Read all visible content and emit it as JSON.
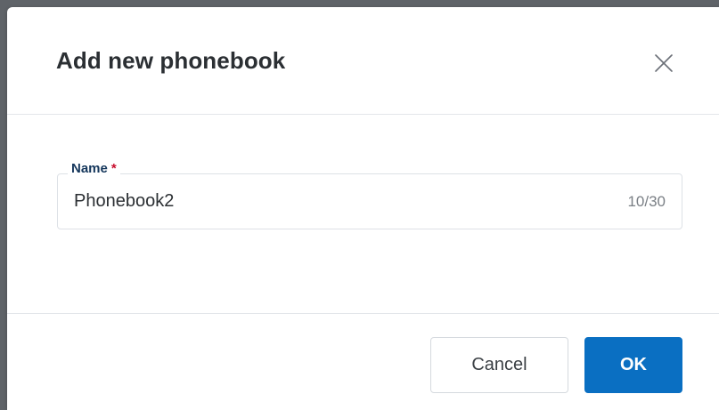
{
  "dialog": {
    "title": "Add new phonebook",
    "close_icon": "close-icon"
  },
  "form": {
    "name_field": {
      "label": "Name",
      "required_marker": "*",
      "value": "Phonebook2",
      "counter": "10/30"
    }
  },
  "footer": {
    "cancel_label": "Cancel",
    "ok_label": "OK"
  },
  "colors": {
    "primary": "#0a6fc2",
    "label": "#15375c",
    "required": "#c8102e"
  }
}
